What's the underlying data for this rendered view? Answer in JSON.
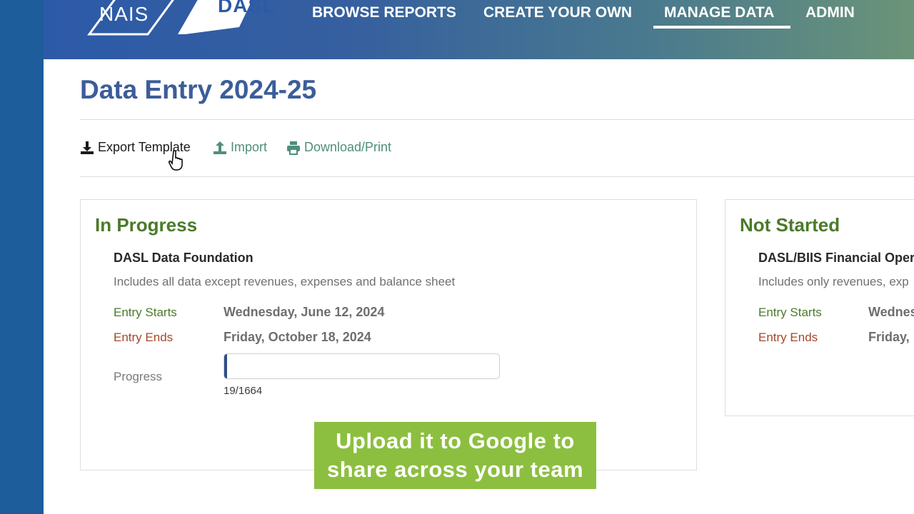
{
  "brand": {
    "nais": "NAIS",
    "dasl": "DASL"
  },
  "nav": {
    "items": [
      {
        "label": "BROWSE REPORTS"
      },
      {
        "label": "CREATE YOUR OWN"
      },
      {
        "label": "MANAGE DATA",
        "active": true
      },
      {
        "label": "ADMIN"
      }
    ]
  },
  "page": {
    "title": "Data Entry 2024-25"
  },
  "toolbar": {
    "export_label": "Export Template",
    "import_label": "Import",
    "print_label": "Download/Print"
  },
  "in_progress": {
    "heading": "In Progress",
    "name": "DASL Data Foundation",
    "description": "Includes all data except revenues, expenses and balance sheet",
    "entry_starts_label": "Entry Starts",
    "entry_starts_value": "Wednesday, June 12, 2024",
    "entry_ends_label": "Entry Ends",
    "entry_ends_value": "Friday, October 18, 2024",
    "progress_label": "Progress",
    "progress_count": "19/1664",
    "progress_fraction": 0.0114
  },
  "not_started": {
    "heading": "Not Started",
    "name": "DASL/BIIS Financial Oper",
    "description": "Includes only revenues, exp",
    "entry_starts_label": "Entry Starts",
    "entry_starts_value": "Wednes",
    "entry_ends_label": "Entry Ends",
    "entry_ends_value": "Friday,"
  },
  "caption": {
    "line1": "Upload it to Google to",
    "line2": "share across your team"
  },
  "colors": {
    "rail": "#1d5d9b",
    "title": "#3c5d9a",
    "green": "#4b7a2a",
    "red": "#a4472b",
    "teal": "#4f8e7c",
    "caption_bg": "#8cbf3f"
  }
}
